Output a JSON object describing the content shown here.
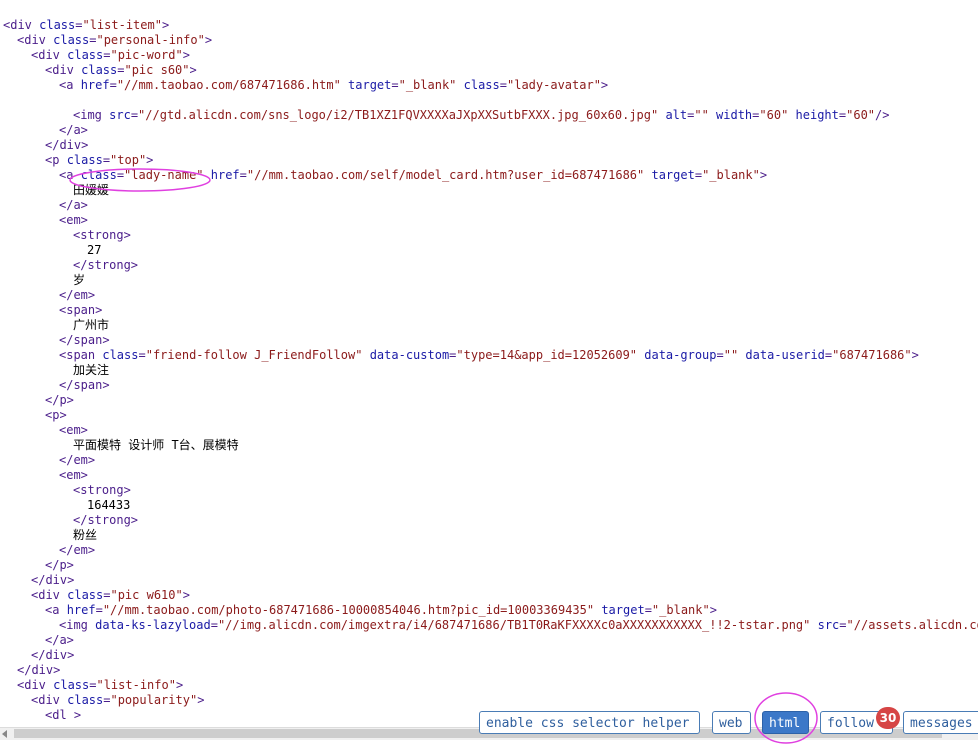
{
  "code_lines": [
    {
      "indent": 0,
      "parts": [
        {
          "t": "tag",
          "v": "<div "
        },
        {
          "t": "attr",
          "v": "class"
        },
        {
          "t": "tag",
          "v": "="
        },
        {
          "t": "val",
          "v": "\"list-item\""
        },
        {
          "t": "tag",
          "v": ">"
        }
      ]
    },
    {
      "indent": 1,
      "parts": [
        {
          "t": "tag",
          "v": "<div "
        },
        {
          "t": "attr",
          "v": "class"
        },
        {
          "t": "tag",
          "v": "="
        },
        {
          "t": "val",
          "v": "\"personal-info\""
        },
        {
          "t": "tag",
          "v": ">"
        }
      ]
    },
    {
      "indent": 2,
      "parts": [
        {
          "t": "tag",
          "v": "<div "
        },
        {
          "t": "attr",
          "v": "class"
        },
        {
          "t": "tag",
          "v": "="
        },
        {
          "t": "val",
          "v": "\"pic-word\""
        },
        {
          "t": "tag",
          "v": ">"
        }
      ]
    },
    {
      "indent": 3,
      "parts": [
        {
          "t": "tag",
          "v": "<div "
        },
        {
          "t": "attr",
          "v": "class"
        },
        {
          "t": "tag",
          "v": "="
        },
        {
          "t": "val",
          "v": "\"pic s60\""
        },
        {
          "t": "tag",
          "v": ">"
        }
      ]
    },
    {
      "indent": 4,
      "parts": [
        {
          "t": "tag",
          "v": "<a "
        },
        {
          "t": "attr",
          "v": "href"
        },
        {
          "t": "tag",
          "v": "="
        },
        {
          "t": "val",
          "v": "\"//mm.taobao.com/687471686.htm\""
        },
        {
          "t": "attr",
          "v": " target"
        },
        {
          "t": "tag",
          "v": "="
        },
        {
          "t": "val",
          "v": "\"_blank\""
        },
        {
          "t": "attr",
          "v": " class"
        },
        {
          "t": "tag",
          "v": "="
        },
        {
          "t": "val",
          "v": "\"lady-avatar\""
        },
        {
          "t": "tag",
          "v": ">"
        }
      ]
    },
    {
      "indent": 0,
      "parts": []
    },
    {
      "indent": 5,
      "parts": [
        {
          "t": "tag",
          "v": "<img "
        },
        {
          "t": "attr",
          "v": "src"
        },
        {
          "t": "tag",
          "v": "="
        },
        {
          "t": "val",
          "v": "\"//gtd.alicdn.com/sns_logo/i2/TB1XZ1FQVXXXXaJXpXXSutbFXXX.jpg_60x60.jpg\""
        },
        {
          "t": "attr",
          "v": " alt"
        },
        {
          "t": "tag",
          "v": "="
        },
        {
          "t": "val",
          "v": "\"\""
        },
        {
          "t": "attr",
          "v": " width"
        },
        {
          "t": "tag",
          "v": "="
        },
        {
          "t": "val",
          "v": "\"60\""
        },
        {
          "t": "attr",
          "v": " height"
        },
        {
          "t": "tag",
          "v": "="
        },
        {
          "t": "val",
          "v": "\"60\""
        },
        {
          "t": "tag",
          "v": "/>"
        }
      ]
    },
    {
      "indent": 4,
      "parts": [
        {
          "t": "tag",
          "v": "</a>"
        }
      ]
    },
    {
      "indent": 3,
      "parts": [
        {
          "t": "tag",
          "v": "</div>"
        }
      ]
    },
    {
      "indent": 3,
      "parts": [
        {
          "t": "tag",
          "v": "<p "
        },
        {
          "t": "attr",
          "v": "class"
        },
        {
          "t": "tag",
          "v": "="
        },
        {
          "t": "val",
          "v": "\"top\""
        },
        {
          "t": "tag",
          "v": ">"
        }
      ]
    },
    {
      "indent": 4,
      "parts": [
        {
          "t": "tag",
          "v": "<a "
        },
        {
          "t": "attr",
          "v": "class"
        },
        {
          "t": "tag",
          "v": "="
        },
        {
          "t": "val",
          "v": "\"lady-name\""
        },
        {
          "t": "attr",
          "v": " href"
        },
        {
          "t": "tag",
          "v": "="
        },
        {
          "t": "val",
          "v": "\"//mm.taobao.com/self/model_card.htm?user_id=687471686\""
        },
        {
          "t": "attr",
          "v": " target"
        },
        {
          "t": "tag",
          "v": "="
        },
        {
          "t": "val",
          "v": "\"_blank\""
        },
        {
          "t": "tag",
          "v": ">"
        }
      ]
    },
    {
      "indent": 5,
      "parts": [
        {
          "t": "txt",
          "v": "田媛媛"
        }
      ]
    },
    {
      "indent": 4,
      "parts": [
        {
          "t": "tag",
          "v": "</a>"
        }
      ]
    },
    {
      "indent": 4,
      "parts": [
        {
          "t": "tag",
          "v": "<em>"
        }
      ]
    },
    {
      "indent": 5,
      "parts": [
        {
          "t": "tag",
          "v": "<strong>"
        }
      ]
    },
    {
      "indent": 6,
      "parts": [
        {
          "t": "txt",
          "v": "27"
        }
      ]
    },
    {
      "indent": 5,
      "parts": [
        {
          "t": "tag",
          "v": "</strong>"
        }
      ]
    },
    {
      "indent": 5,
      "parts": [
        {
          "t": "txt",
          "v": "岁"
        }
      ]
    },
    {
      "indent": 4,
      "parts": [
        {
          "t": "tag",
          "v": "</em>"
        }
      ]
    },
    {
      "indent": 4,
      "parts": [
        {
          "t": "tag",
          "v": "<span>"
        }
      ]
    },
    {
      "indent": 5,
      "parts": [
        {
          "t": "txt",
          "v": "广州市"
        }
      ]
    },
    {
      "indent": 4,
      "parts": [
        {
          "t": "tag",
          "v": "</span>"
        }
      ]
    },
    {
      "indent": 4,
      "parts": [
        {
          "t": "tag",
          "v": "<span "
        },
        {
          "t": "attr",
          "v": "class"
        },
        {
          "t": "tag",
          "v": "="
        },
        {
          "t": "val",
          "v": "\"friend-follow J_FriendFollow\""
        },
        {
          "t": "attr",
          "v": " data-custom"
        },
        {
          "t": "tag",
          "v": "="
        },
        {
          "t": "val",
          "v": "\"type=14&app_id=12052609\""
        },
        {
          "t": "attr",
          "v": " data-group"
        },
        {
          "t": "tag",
          "v": "="
        },
        {
          "t": "val",
          "v": "\"\""
        },
        {
          "t": "attr",
          "v": " data-userid"
        },
        {
          "t": "tag",
          "v": "="
        },
        {
          "t": "val",
          "v": "\"687471686\""
        },
        {
          "t": "tag",
          "v": ">"
        }
      ]
    },
    {
      "indent": 5,
      "parts": [
        {
          "t": "txt",
          "v": "加关注"
        }
      ]
    },
    {
      "indent": 4,
      "parts": [
        {
          "t": "tag",
          "v": "</span>"
        }
      ]
    },
    {
      "indent": 3,
      "parts": [
        {
          "t": "tag",
          "v": "</p>"
        }
      ]
    },
    {
      "indent": 3,
      "parts": [
        {
          "t": "tag",
          "v": "<p>"
        }
      ]
    },
    {
      "indent": 4,
      "parts": [
        {
          "t": "tag",
          "v": "<em>"
        }
      ]
    },
    {
      "indent": 5,
      "parts": [
        {
          "t": "txt",
          "v": "平面模特 设计师 T台、展模特"
        }
      ]
    },
    {
      "indent": 4,
      "parts": [
        {
          "t": "tag",
          "v": "</em>"
        }
      ]
    },
    {
      "indent": 4,
      "parts": [
        {
          "t": "tag",
          "v": "<em>"
        }
      ]
    },
    {
      "indent": 5,
      "parts": [
        {
          "t": "tag",
          "v": "<strong>"
        }
      ]
    },
    {
      "indent": 6,
      "parts": [
        {
          "t": "txt",
          "v": "164433"
        }
      ]
    },
    {
      "indent": 5,
      "parts": [
        {
          "t": "tag",
          "v": "</strong>"
        }
      ]
    },
    {
      "indent": 5,
      "parts": [
        {
          "t": "txt",
          "v": "粉丝"
        }
      ]
    },
    {
      "indent": 4,
      "parts": [
        {
          "t": "tag",
          "v": "</em>"
        }
      ]
    },
    {
      "indent": 3,
      "parts": [
        {
          "t": "tag",
          "v": "</p>"
        }
      ]
    },
    {
      "indent": 2,
      "parts": [
        {
          "t": "tag",
          "v": "</div>"
        }
      ]
    },
    {
      "indent": 2,
      "parts": [
        {
          "t": "tag",
          "v": "<div "
        },
        {
          "t": "attr",
          "v": "class"
        },
        {
          "t": "tag",
          "v": "="
        },
        {
          "t": "val",
          "v": "\"pic w610\""
        },
        {
          "t": "tag",
          "v": ">"
        }
      ]
    },
    {
      "indent": 3,
      "parts": [
        {
          "t": "tag",
          "v": "<a "
        },
        {
          "t": "attr",
          "v": "href"
        },
        {
          "t": "tag",
          "v": "="
        },
        {
          "t": "val",
          "v": "\"//mm.taobao.com/photo-687471686-10000854046.htm?pic_id=10003369435\""
        },
        {
          "t": "attr",
          "v": " target"
        },
        {
          "t": "tag",
          "v": "="
        },
        {
          "t": "val",
          "v": "\"_blank\""
        },
        {
          "t": "tag",
          "v": ">"
        }
      ]
    },
    {
      "indent": 4,
      "parts": [
        {
          "t": "tag",
          "v": "<img "
        },
        {
          "t": "attr",
          "v": "data-ks-lazyload"
        },
        {
          "t": "tag",
          "v": "="
        },
        {
          "t": "val",
          "v": "\"//img.alicdn.com/imgextra/i4/687471686/TB1T0RaKFXXXXc0aXXXXXXXXXXX_!!2-tstar.png\""
        },
        {
          "t": "attr",
          "v": " src"
        },
        {
          "t": "tag",
          "v": "="
        },
        {
          "t": "val",
          "v": "\"//assets.alicdn.com/ki"
        }
      ]
    },
    {
      "indent": 3,
      "parts": [
        {
          "t": "tag",
          "v": "</a>"
        }
      ]
    },
    {
      "indent": 2,
      "parts": [
        {
          "t": "tag",
          "v": "</div>"
        }
      ]
    },
    {
      "indent": 1,
      "parts": [
        {
          "t": "tag",
          "v": "</div>"
        }
      ]
    },
    {
      "indent": 1,
      "parts": [
        {
          "t": "tag",
          "v": "<div "
        },
        {
          "t": "attr",
          "v": "class"
        },
        {
          "t": "tag",
          "v": "="
        },
        {
          "t": "val",
          "v": "\"list-info\""
        },
        {
          "t": "tag",
          "v": ">"
        }
      ]
    },
    {
      "indent": 2,
      "parts": [
        {
          "t": "tag",
          "v": "<div "
        },
        {
          "t": "attr",
          "v": "class"
        },
        {
          "t": "tag",
          "v": "="
        },
        {
          "t": "val",
          "v": "\"popularity\""
        },
        {
          "t": "tag",
          "v": ">"
        }
      ]
    },
    {
      "indent": 3,
      "parts": [
        {
          "t": "tag",
          "v": "<dl >"
        }
      ]
    }
  ],
  "toolbar": {
    "css_helper_label": "enable css selector helper",
    "web_label": "web",
    "html_label": "html",
    "follow_label": "follow",
    "messages_label": "messages",
    "follow_badge": "30"
  },
  "annotation_color": "#e040e0",
  "colors": {
    "tag": "#4a1d8a",
    "attr": "#1a1aa6",
    "val": "#8b1a1a",
    "accent": "#3c78c8"
  }
}
